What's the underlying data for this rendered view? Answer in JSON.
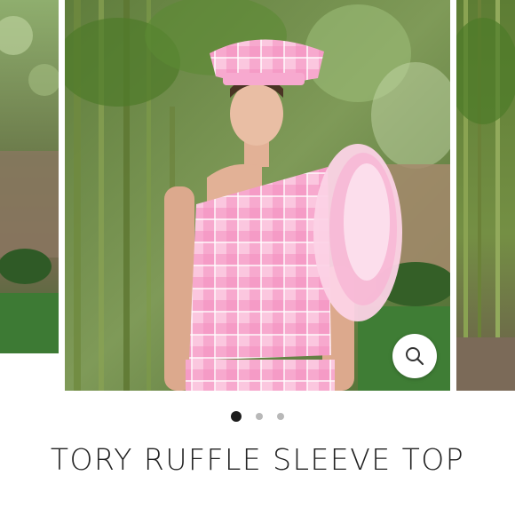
{
  "product": {
    "title": "TORY RUFFLE SLEEVE TOP"
  },
  "gallery": {
    "image_count": 3,
    "active_index": 0,
    "zoom_icon": "magnifier-icon",
    "main_image_alt": "",
    "colors": {
      "accent_pink": "#f49ac8",
      "active_dot": "#1c1c1c",
      "inactive_dot": "#b8b8b8"
    }
  }
}
